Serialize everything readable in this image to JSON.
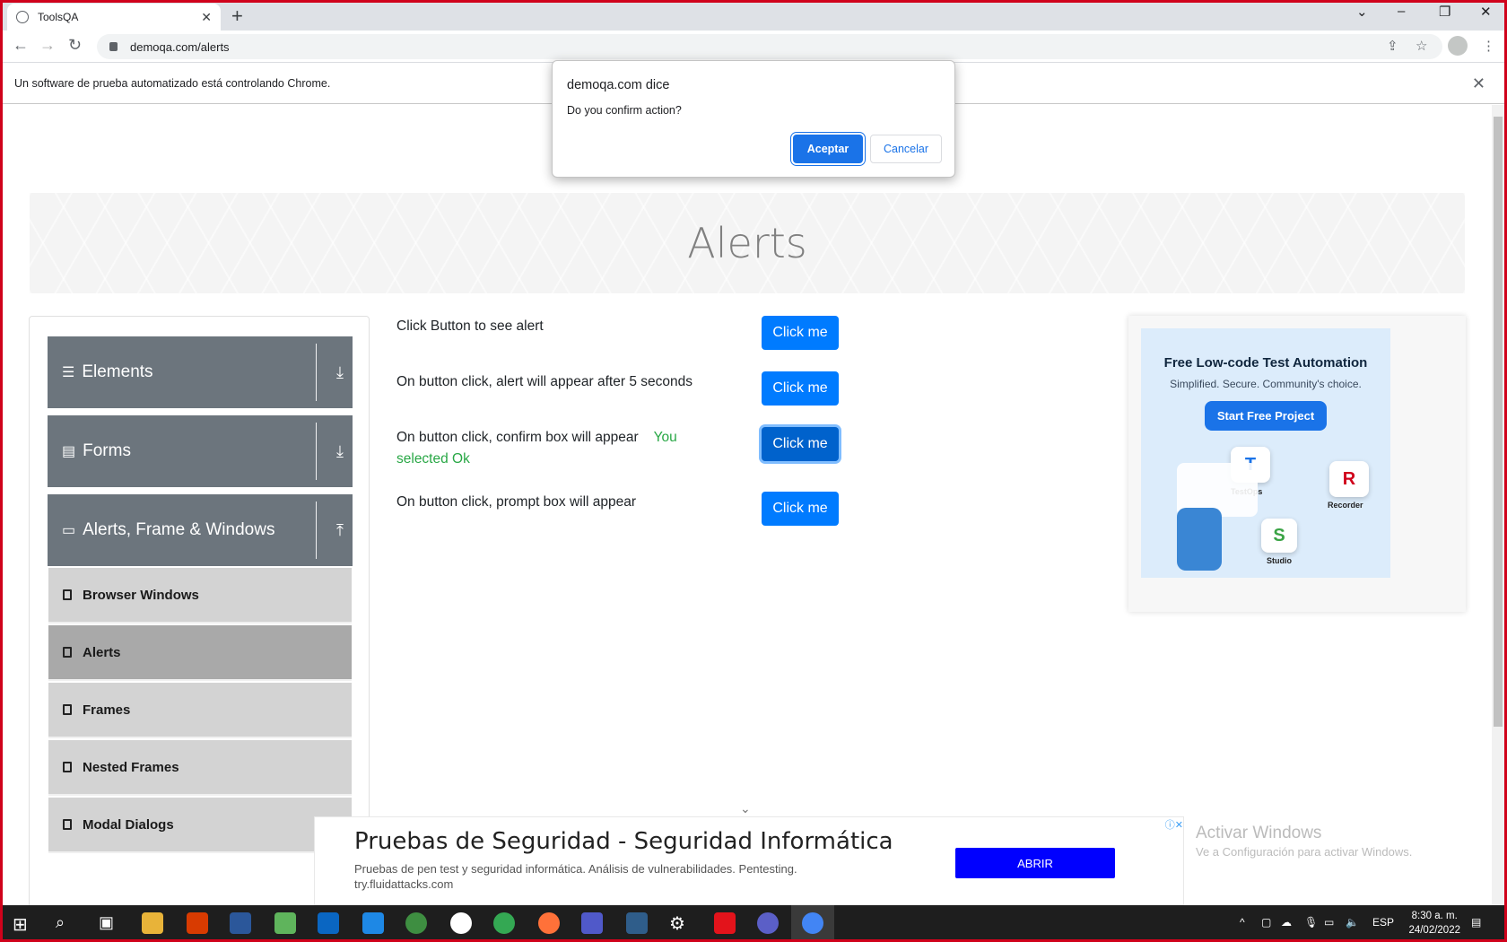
{
  "browser": {
    "tab_title": "ToolsQA",
    "url": "demoqa.com/alerts",
    "infobar_text": "Un software de prueba automatizado está controlando Chrome."
  },
  "dialog": {
    "title": "demoqa.com dice",
    "message": "Do you confirm action?",
    "ok_label": "Aceptar",
    "cancel_label": "Cancelar"
  },
  "page": {
    "title": "Alerts"
  },
  "sidebar": {
    "groups": [
      {
        "label": "Elements"
      },
      {
        "label": "Forms"
      },
      {
        "label": "Alerts, Frame & Windows"
      }
    ],
    "items": [
      {
        "label": "Browser Windows"
      },
      {
        "label": "Alerts"
      },
      {
        "label": "Frames"
      },
      {
        "label": "Nested Frames"
      },
      {
        "label": "Modal Dialogs"
      }
    ]
  },
  "main": {
    "rows": [
      {
        "text": "Click Button to see alert",
        "button": "Click me"
      },
      {
        "text": "On button click, alert will appear after 5 seconds",
        "button": "Click me"
      },
      {
        "text": "On button click, confirm box will appear",
        "result": "You selected Ok",
        "button": "Click me"
      },
      {
        "text": "On button click, prompt box will appear",
        "button": "Click me"
      }
    ]
  },
  "ad_side": {
    "title": "Free Low-code Test Automation",
    "subtitle": "Simplified. Secure. Community's choice.",
    "cta": "Start Free Project",
    "labels": [
      "TestOps",
      "Recorder",
      "Studio"
    ]
  },
  "ad_bottom": {
    "headline": "Pruebas de Seguridad - Seguridad Informática",
    "description": "Pruebas de pen test y seguridad informática. Análisis de vulnerabilidades. Pentesting.",
    "url": "try.fluidattacks.com",
    "button": "ABRIR"
  },
  "watermark": {
    "line1": "Activar Windows",
    "line2": "Ve a Configuración para activar Windows."
  },
  "taskbar": {
    "language": "ESP",
    "time": "8:30 a. m.",
    "date": "24/02/2022"
  }
}
